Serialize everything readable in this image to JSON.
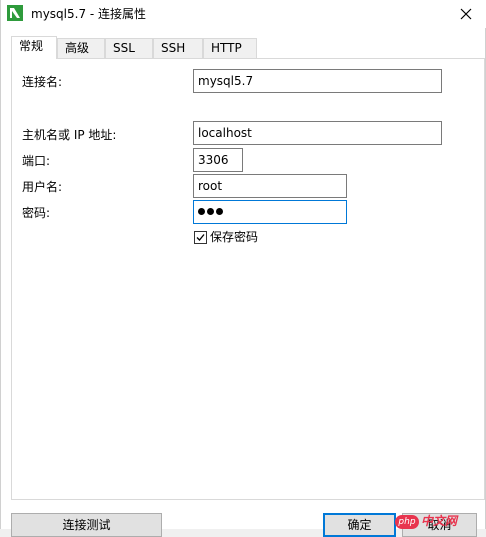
{
  "window": {
    "title": "mysql5.7 - 连接属性",
    "icon": "navicat-leaf-icon",
    "close_glyph": "✕"
  },
  "tabs": [
    {
      "label": "常规",
      "active": true
    },
    {
      "label": "高级",
      "active": false
    },
    {
      "label": "SSL",
      "active": false
    },
    {
      "label": "SSH",
      "active": false
    },
    {
      "label": "HTTP",
      "active": false
    }
  ],
  "form": {
    "connection_name_label": "连接名:",
    "connection_name_value": "mysql5.7",
    "host_label": "主机名或 IP 地址:",
    "host_value": "localhost",
    "port_label": "端口:",
    "port_value": "3306",
    "username_label": "用户名:",
    "username_value": "root",
    "password_label": "密码:",
    "password_masked_length": 3,
    "save_password_label": "保存密码",
    "save_password_checked": true
  },
  "buttons": {
    "test_connection": "连接测试",
    "ok": "确定",
    "cancel": "取消"
  },
  "watermark": {
    "logo_text": "php",
    "text": "中文网"
  },
  "colors": {
    "accent": "#0078d7",
    "watermark": "#e8344e",
    "icon_green": "#2e9b3c"
  }
}
